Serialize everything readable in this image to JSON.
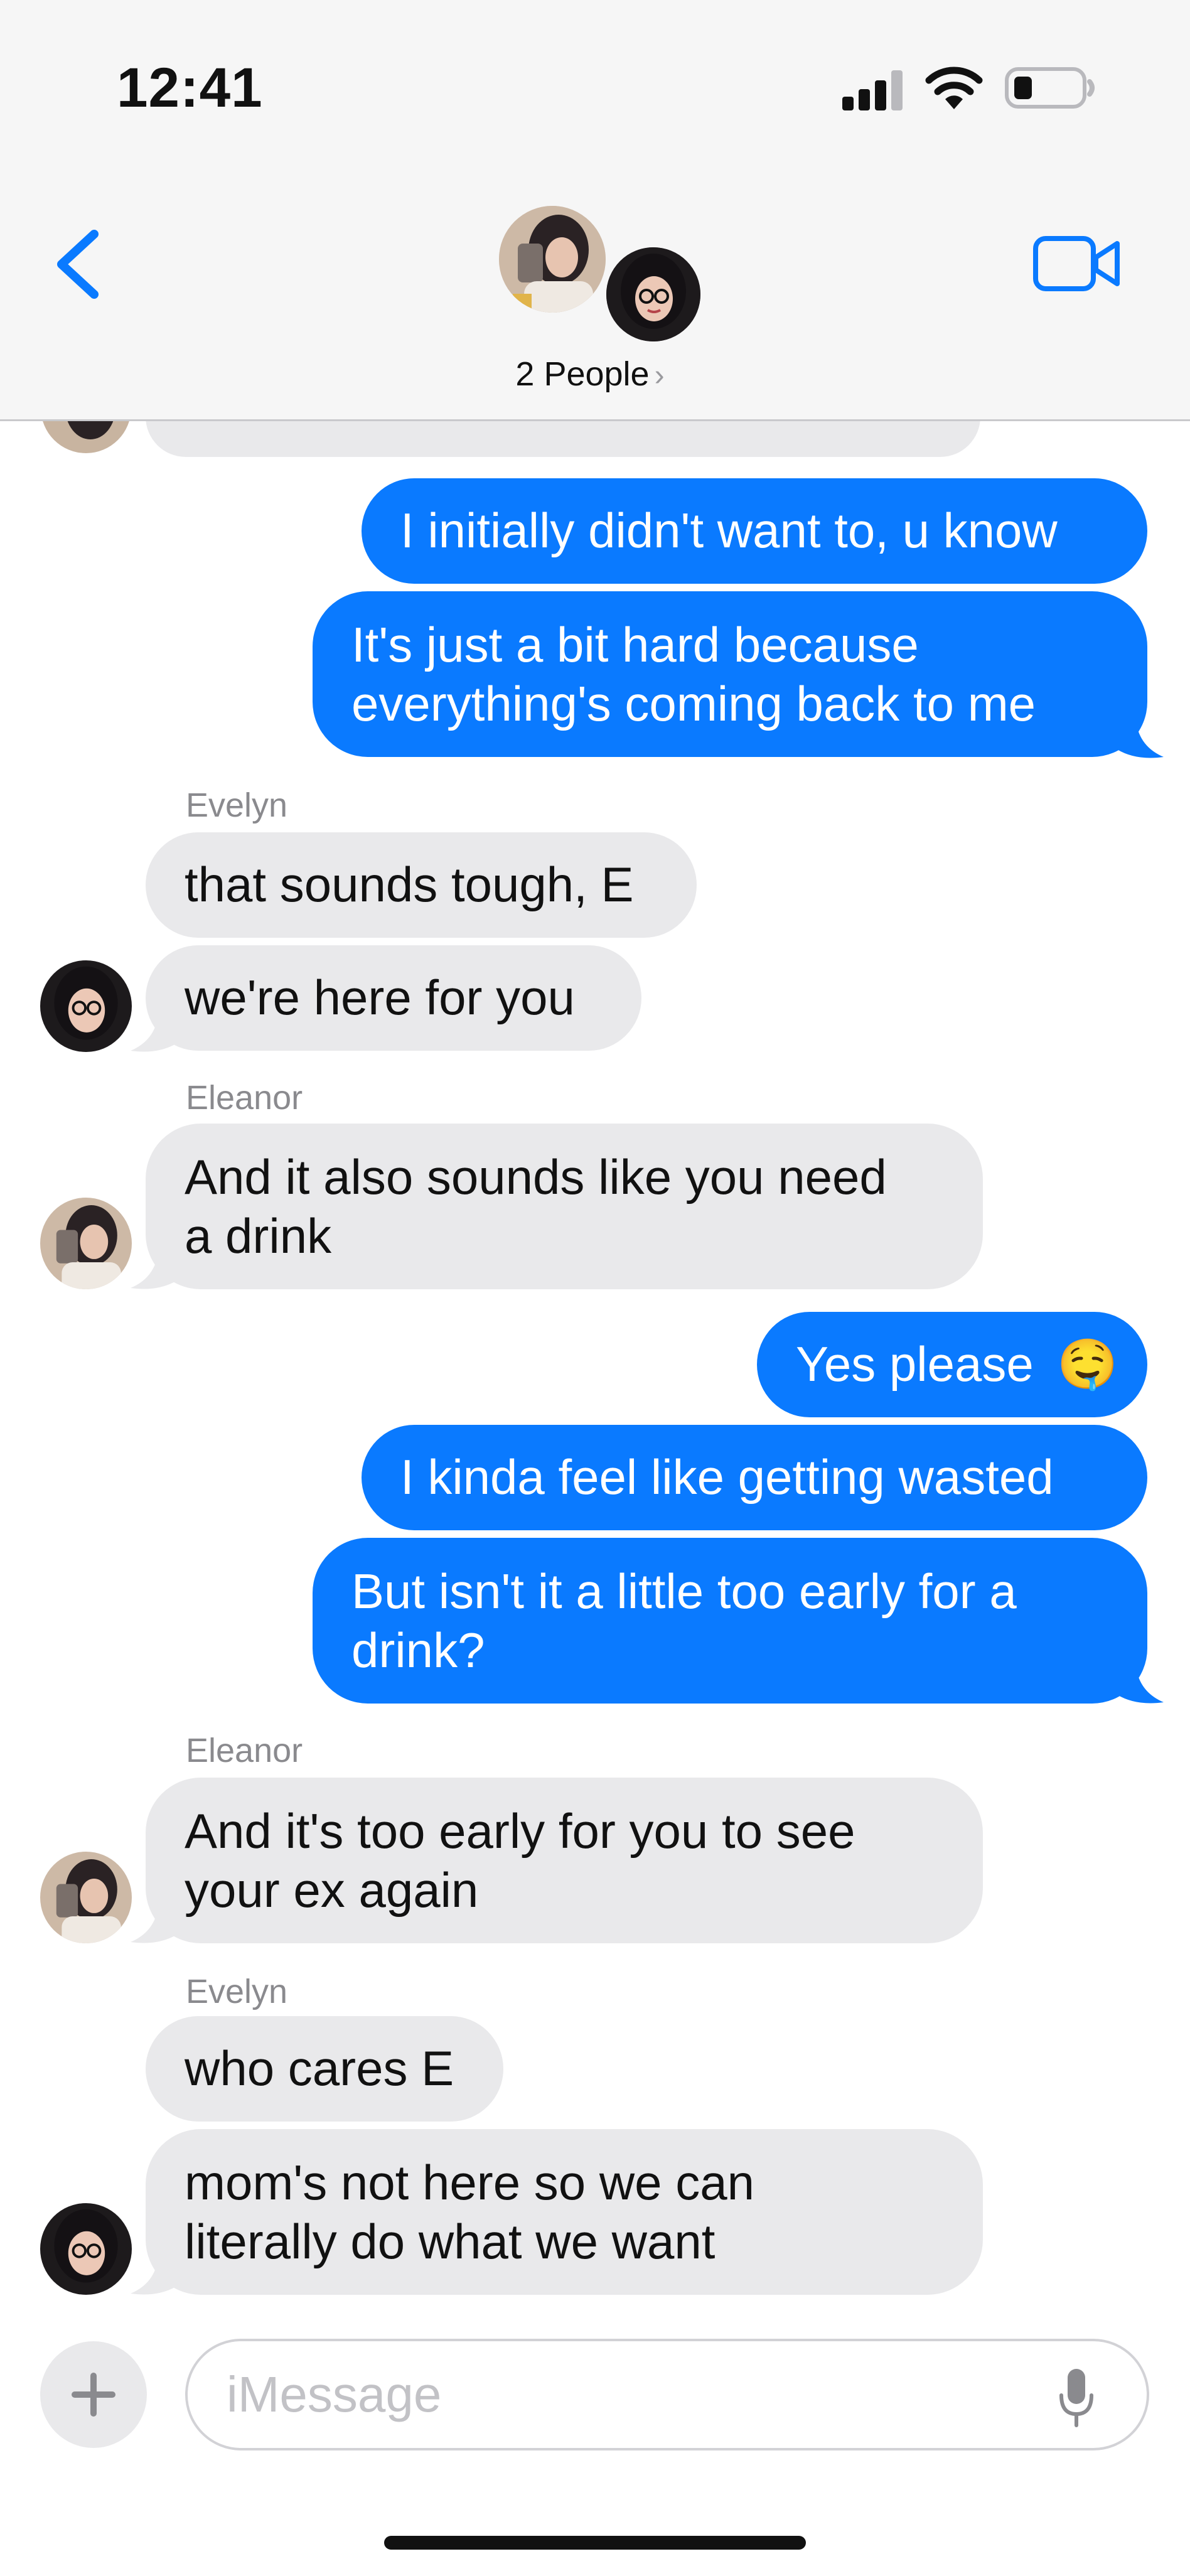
{
  "status_bar": {
    "time": "12:41"
  },
  "header": {
    "people_label": "2 People",
    "people_chevron": "›"
  },
  "colors": {
    "sent_bubble": "#0a7aff",
    "received_bubble": "#e9e9eb",
    "accent": "#0a7aff"
  },
  "messages": [
    {
      "sender": "Eleanor",
      "type": "received",
      "text": ""
    },
    {
      "type": "sent",
      "text": "I initially didn't want to, u know"
    },
    {
      "type": "sent",
      "lines": [
        "It's just a bit hard because",
        "everything's coming back to me"
      ]
    },
    {
      "sender_label": "Evelyn",
      "type": "received",
      "text": "that sounds tough, E"
    },
    {
      "type": "received",
      "text": "we're here for you"
    },
    {
      "sender_label": "Eleanor",
      "type": "received",
      "lines": [
        "And it also sounds like you need",
        "a drink"
      ]
    },
    {
      "type": "sent",
      "text": "Yes please",
      "emoji": "🤤"
    },
    {
      "type": "sent",
      "text": "I kinda feel like getting wasted"
    },
    {
      "type": "sent",
      "lines": [
        "But isn't it a little too early for a",
        "drink?"
      ]
    },
    {
      "sender_label": "Eleanor",
      "type": "received",
      "lines": [
        "And it's too early for you to see",
        "your ex again"
      ]
    },
    {
      "sender_label": "Evelyn",
      "type": "received",
      "text": "who cares E"
    },
    {
      "type": "received",
      "lines": [
        "mom's not here so we can",
        "literally do what we want"
      ]
    }
  ],
  "composer": {
    "placeholder": "iMessage"
  },
  "icons": {
    "back": "chevron-left-icon",
    "video": "video-camera-icon",
    "plus": "plus-icon",
    "mic": "microphone-icon",
    "signal": "cellular-signal-icon",
    "wifi": "wifi-icon",
    "battery": "battery-icon"
  }
}
